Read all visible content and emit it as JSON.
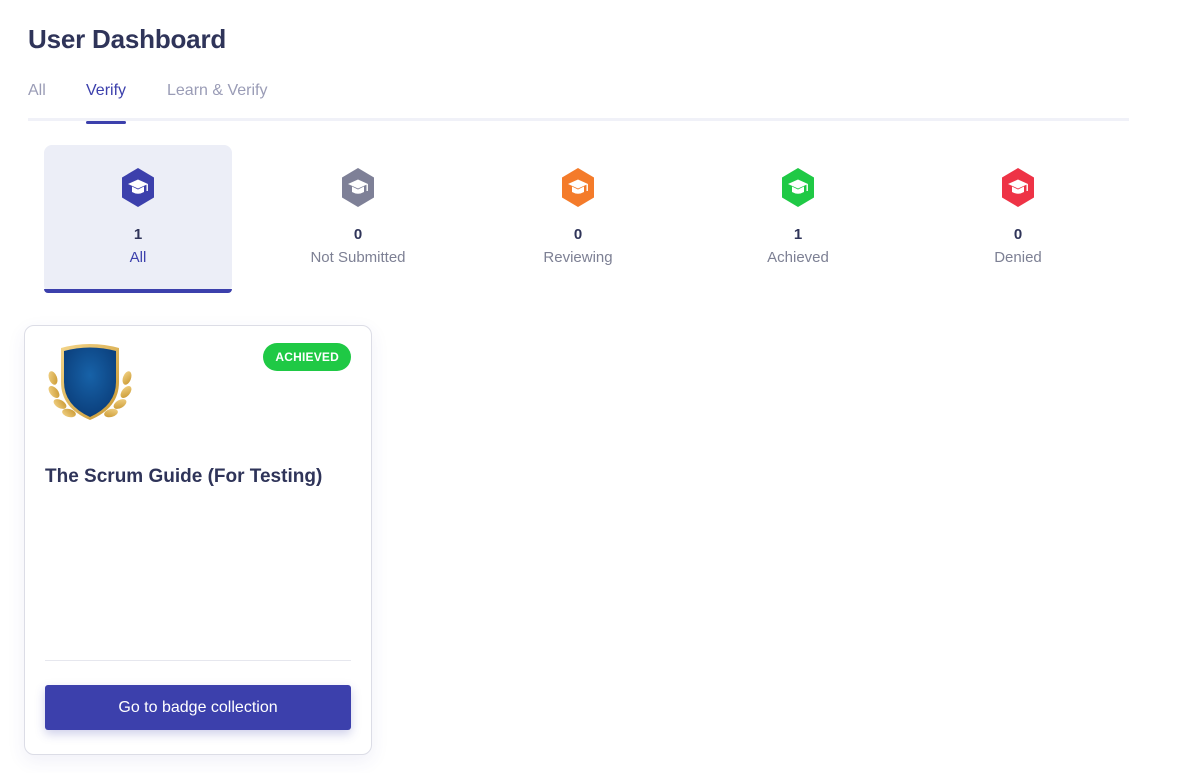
{
  "page_title": "User Dashboard",
  "tabs": [
    {
      "label": "All",
      "active": false
    },
    {
      "label": "Verify",
      "active": true
    },
    {
      "label": "Learn & Verify",
      "active": false
    }
  ],
  "filters": [
    {
      "count": "1",
      "label": "All",
      "color": "#3c40ac",
      "icon": "graduation-cap-icon",
      "active": true
    },
    {
      "count": "0",
      "label": "Not Submitted",
      "color": "#7e8097",
      "icon": "graduation-cap-icon",
      "active": false
    },
    {
      "count": "0",
      "label": "Reviewing",
      "color": "#f47b2a",
      "icon": "graduation-cap-icon",
      "active": false
    },
    {
      "count": "1",
      "label": "Achieved",
      "color": "#1fc945",
      "icon": "graduation-cap-icon",
      "active": false
    },
    {
      "count": "0",
      "label": "Denied",
      "color": "#ee3346",
      "icon": "graduation-cap-icon",
      "active": false
    }
  ],
  "card": {
    "status": "ACHIEVED",
    "status_color": "#1fc945",
    "title": "The Scrum Guide (For Testing)",
    "button_label": "Go to badge collection",
    "badge_icon": "shield-laurel-badge-icon"
  },
  "colors": {
    "accent": "#3c40ac",
    "heading": "#2f3459"
  }
}
